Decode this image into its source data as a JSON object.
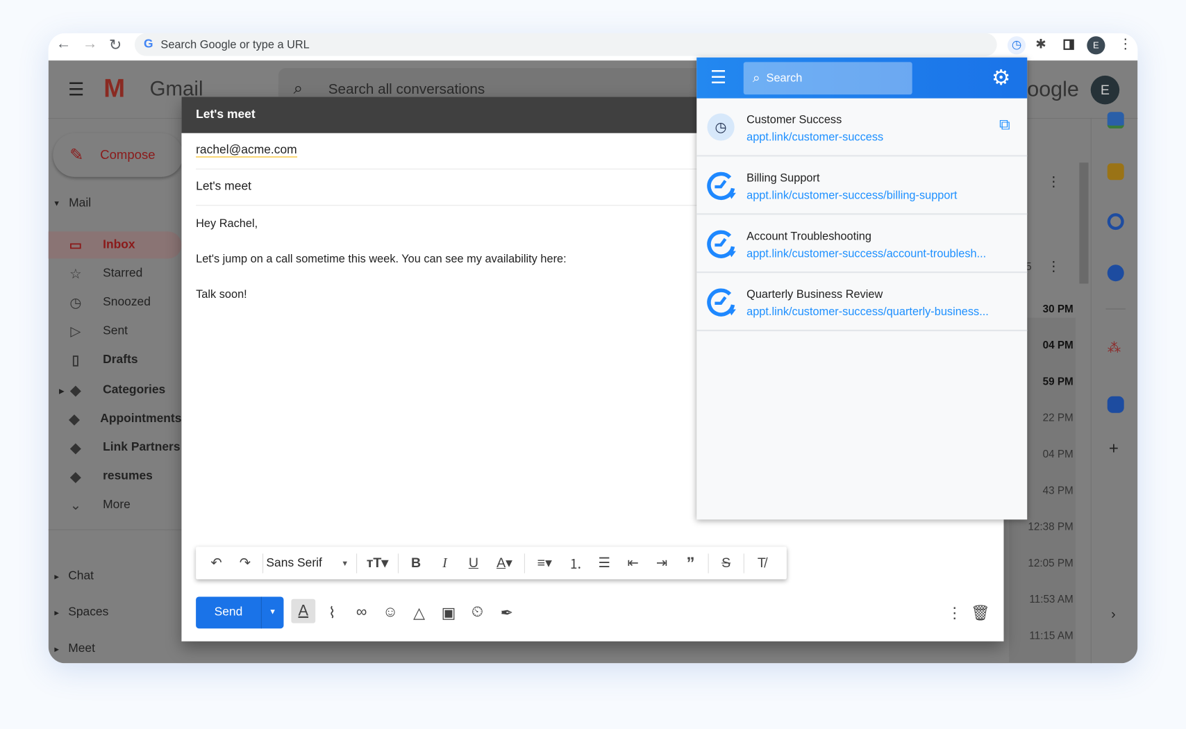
{
  "browser": {
    "address_placeholder": "Search Google or type a URL",
    "profile_initial": "E"
  },
  "gmail": {
    "app_name": "Gmail",
    "search_placeholder": "Search all conversations",
    "brand_partial": "oogle",
    "avatar_initial": "E",
    "compose_label": "Compose",
    "mail_section": "Mail",
    "folders": [
      {
        "label": "Inbox",
        "icon": "inbox-icon"
      },
      {
        "label": "Starred",
        "icon": "star-icon"
      },
      {
        "label": "Snoozed",
        "icon": "clock-icon"
      },
      {
        "label": "Sent",
        "icon": "send-icon"
      },
      {
        "label": "Drafts",
        "icon": "draft-icon"
      },
      {
        "label": "Categories",
        "icon": "label-icon"
      },
      {
        "label": "Appointments",
        "icon": "label-icon"
      },
      {
        "label": "Link Partners",
        "icon": "label-icon"
      },
      {
        "label": "resumes",
        "icon": "label-icon"
      },
      {
        "label": "More",
        "icon": "chevron-down-icon"
      }
    ],
    "sections": [
      "Chat",
      "Spaces",
      "Meet"
    ],
    "partial_count": "5",
    "times": [
      "30 PM",
      "04 PM",
      "59 PM",
      "22 PM",
      "04 PM",
      "43 PM",
      "12:38 PM",
      "12:05 PM",
      "11:53 AM",
      "11:15 AM"
    ]
  },
  "compose": {
    "title": "Let's meet",
    "to": "rachel@acme.com",
    "subject": "Let's meet",
    "body": [
      "Hey Rachel,",
      "Let's jump on a call sometime this week. You can see my availability here:",
      "Talk soon!"
    ],
    "font": "Sans Serif",
    "send_label": "Send"
  },
  "popup": {
    "search_placeholder": "Search",
    "accent": "#1a73e8",
    "items": [
      {
        "title": "Customer Success",
        "link": "appt.link/customer-success"
      },
      {
        "title": "Billing Support",
        "link": "appt.link/customer-success/billing-support"
      },
      {
        "title": "Account Troubleshooting",
        "link": "appt.link/customer-success/account-troublesh..."
      },
      {
        "title": "Quarterly Business Review",
        "link": "appt.link/customer-success/quarterly-business..."
      }
    ]
  }
}
